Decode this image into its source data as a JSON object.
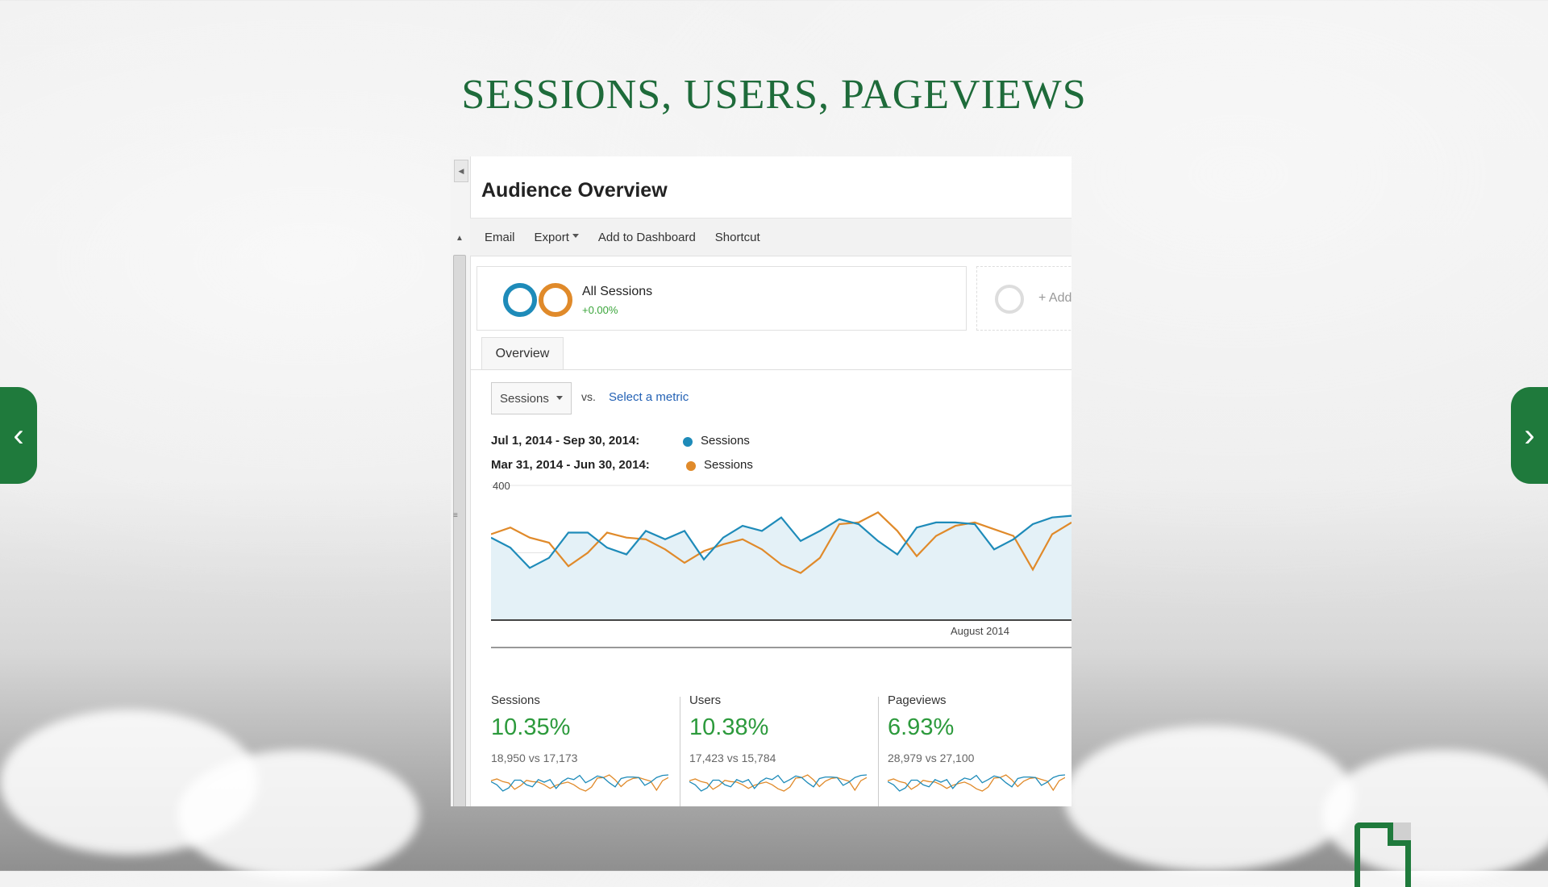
{
  "slide": {
    "title": "SESSIONS, USERS, PAGEVIEWS"
  },
  "app": {
    "page_title": "Audience Overview",
    "toolbar": {
      "email": "Email",
      "export": "Export",
      "add_to_dashboard": "Add to Dashboard",
      "shortcut": "Shortcut"
    },
    "segment": {
      "name": "All Sessions",
      "change": "+0.00%",
      "add_label": "+ Add"
    },
    "tabs": [
      "Overview"
    ],
    "metric_selector": {
      "selected": "Sessions",
      "vs": "vs.",
      "select_metric": "Select a metric"
    },
    "legend": [
      {
        "range": "Jul 1, 2014 - Sep 30, 2014:",
        "series": "Sessions",
        "color": "#1e8bb9"
      },
      {
        "range": "Mar 31, 2014 - Jun 30, 2014:",
        "series": "Sessions",
        "color": "#e08a2a"
      }
    ],
    "stats": [
      {
        "label": "Sessions",
        "value": "10.35%",
        "compare": "18,950 vs 17,173"
      },
      {
        "label": "Users",
        "value": "10.38%",
        "compare": "17,423 vs 15,784"
      },
      {
        "label": "Pageviews",
        "value": "6.93%",
        "compare": "28,979 vs 27,100"
      }
    ]
  },
  "chart_data": {
    "type": "line",
    "y_ticks": [
      "400",
      "200"
    ],
    "ylim": [
      0,
      400
    ],
    "x_label_text": "August 2014",
    "series": [
      {
        "name": "Sessions",
        "color": "#1e8bb9",
        "values": [
          245,
          215,
          155,
          185,
          260,
          260,
          215,
          195,
          265,
          240,
          265,
          180,
          245,
          280,
          265,
          305,
          235,
          265,
          300,
          285,
          235,
          195,
          275,
          290,
          290,
          285,
          210,
          240,
          285,
          305,
          310
        ]
      },
      {
        "name": "Sessions",
        "color": "#e08a2a",
        "values": [
          255,
          275,
          245,
          230,
          160,
          200,
          260,
          245,
          240,
          210,
          170,
          205,
          225,
          240,
          210,
          165,
          140,
          185,
          285,
          290,
          320,
          265,
          190,
          250,
          280,
          290,
          270,
          250,
          150,
          255,
          290
        ]
      }
    ]
  },
  "colors": {
    "accent": "#1f7a3c",
    "link": "#2462b5",
    "positive": "#2c9a3c"
  }
}
